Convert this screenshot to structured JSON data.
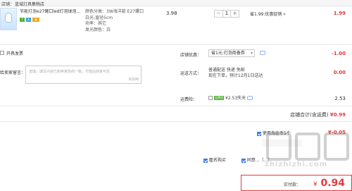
{
  "shop": {
    "label": "店铺：",
    "name": "蓝城灯具集物店"
  },
  "item": {
    "title": "节能灯泡e27螺口led灯泡球泡...",
    "specs": [
      "颜色分类：3W海洋款 E27螺口",
      "白光-直径5cm",
      "功率：其它",
      "发光颜色：白"
    ],
    "unit_price": "3.98",
    "quantity": "1",
    "minus": "−",
    "plus": "+",
    "savings": "省1.99:优惠促销",
    "savings_chevron": "▾",
    "subtotal": "1.99"
  },
  "invoice": {
    "label": "开具发票"
  },
  "discount": {
    "label": "店铺优惠：",
    "selected": "省1元:灯泡商备券",
    "amount": "-1.00"
  },
  "message": {
    "label": "给卖家留言：",
    "placeholder": "选填，填写内容已和卖家协商一致，付款后商家可见",
    "counter": "0/200"
  },
  "shipping": {
    "label": "运送方式：",
    "line1": "普通配送 快递 免邮",
    "line2": "现在下单，预计12月1日送达",
    "price": "0.00"
  },
  "insurance": {
    "label": "运费险：",
    "badge": "运费险",
    "text": "¥2.53失天",
    "price": "2.53"
  },
  "store_total": {
    "label": "店铺合计(含运费)",
    "amount": "¥0.99"
  },
  "points": {
    "label": "使用淘金币5个",
    "amount": "¥-0.05"
  },
  "anonymous": {
    "label": "匿名购买"
  },
  "tail_text": "同意...（...）",
  "payment": {
    "label": "实付款：",
    "currency": "¥",
    "amount": "0.94"
  },
  "watermark": {
    "line1": "值值值",
    "site": "zhizhizhi.com"
  },
  "colors": {
    "accent": "#e4393c",
    "check": "#3a7ee3"
  }
}
